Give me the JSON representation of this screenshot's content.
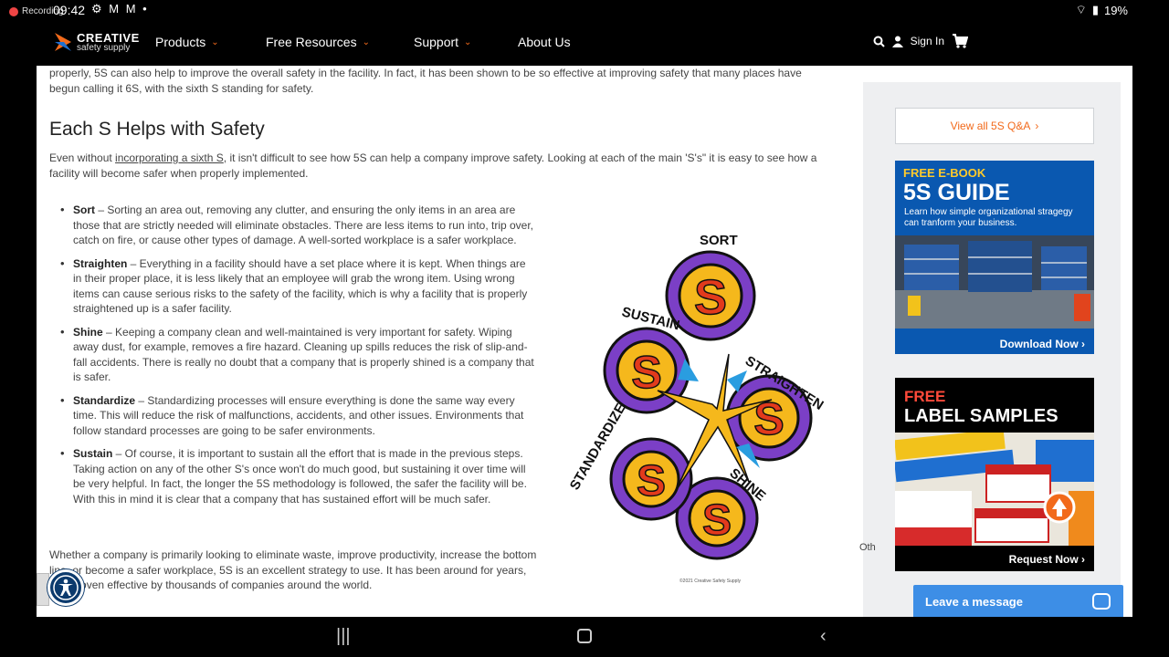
{
  "status": {
    "recording": "Recording",
    "time": "09:42",
    "left_icons": "⚙ M M •",
    "battery": "19%"
  },
  "nav": {
    "logo_title": "CREATIVE",
    "logo_sub": "safety supply",
    "items": [
      "Products",
      "Free Resources",
      "Support",
      "About Us"
    ],
    "signin": "Sign In"
  },
  "article": {
    "intro": "properly, 5S can also help to improve the overall safety in the facility. In fact, it has been shown to be so effective at improving safety that many places have begun calling it 6S, with the sixth S standing for safety.",
    "heading": "Each S Helps with Safety",
    "lead_pre": "Even without ",
    "lead_link": "incorporating a sixth S",
    "lead_post": ", it isn't difficult to see how 5S can help a company improve safety. Looking at each of the main 'S's\" it is easy to see how a facility will become safer when properly implemented.",
    "items": [
      {
        "term": "Sort",
        "text": " – Sorting an area out, removing any clutter, and ensuring the only items in an area are those that are strictly needed will eliminate obstacles. There are less items to run into, trip over, catch on fire, or cause other types of damage. A well-sorted workplace is a safer workplace."
      },
      {
        "term": "Straighten",
        "text": " – Everything in a facility should have a set place where it is kept. When things are in their proper place, it is less likely that an employee will grab the wrong item. Using wrong items can cause serious risks to the safety of the facility, which is why a facility that is properly straightened up is a safer facility."
      },
      {
        "term": "Shine",
        "text": " – Keeping a company clean and well-maintained is very important for safety. Wiping away dust, for example, removes a fire hazard. Cleaning up spills reduces the risk of slip-and-fall accidents. There is really no doubt that a company that is properly shined is a company that is safer."
      },
      {
        "term": "Standardize",
        "text": " – Standardizing processes will ensure everything is done the same way every time. This will reduce the risk of malfunctions, accidents, and other issues. Environments that follow standard processes are going to be safer environments."
      },
      {
        "term": "Sustain",
        "text": " – Of course, it is important to sustain all the effort that is made in the previous steps. Taking action on any of the other S's once won't do much good, but sustaining it over time will be very helpful. In fact, the longer the 5S methodology is followed, the safer the facility will be. With this in mind it is clear that a company that has sustained effort will be much safer."
      }
    ],
    "closing": "Whether a company is primarily looking to eliminate waste, improve productivity, increase the bottom line, or become a safer workplace, 5S is an excellent strategy to use. It has been around for years, and proven effective by thousands of companies around the world.",
    "figure_labels": {
      "sort": "SORT",
      "straighten": "STRAIGHTEN",
      "shine": "SHINE",
      "standardize": "STANDARDIZE",
      "sustain": "SUSTAIN",
      "letter": "S",
      "credit": "©2021 Creative Safety Supply"
    }
  },
  "sidebar": {
    "qa_button": "View all 5S Q&A",
    "ebook": {
      "kicker": "FREE E-BOOK",
      "title": "5S GUIDE",
      "desc": "Learn how simple organizational stragegy can tranform your business.",
      "cta": "Download Now ›"
    },
    "labels": {
      "kicker": "FREE",
      "title": "LABEL SAMPLES",
      "cta": "Request Now ›"
    },
    "partial": "Oth"
  },
  "chat": {
    "label": "Leave a message"
  },
  "colors": {
    "accent": "#f26a1b",
    "blue": "#0a58b0",
    "chat": "#3d8ee6"
  }
}
